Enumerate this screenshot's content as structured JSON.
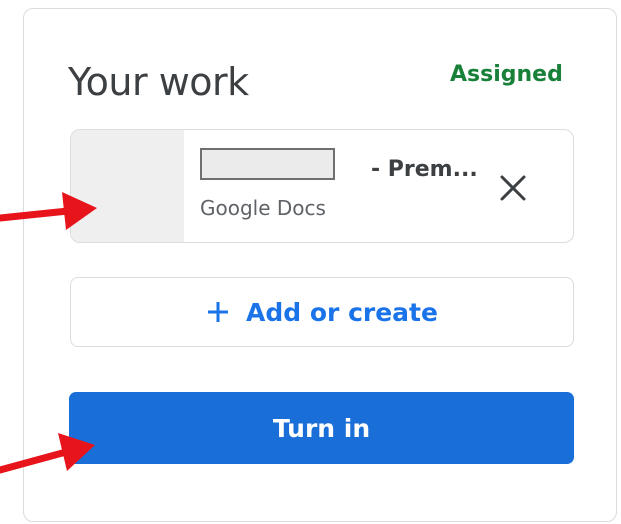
{
  "panel": {
    "title": "Your work",
    "status": "Assigned"
  },
  "attachment": {
    "title_suffix": "- Prem...",
    "type": "Google Docs",
    "remove_icon": "close-icon"
  },
  "actions": {
    "add_label": "Add or create",
    "add_icon": "plus-icon",
    "turn_in_label": "Turn in"
  },
  "colors": {
    "status": "#188038",
    "accent": "#1a73e8",
    "primary_button": "#1a6ed8",
    "annotation_arrow": "#e8141c"
  }
}
